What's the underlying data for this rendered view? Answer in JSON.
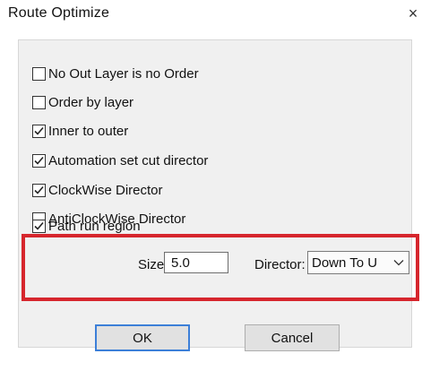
{
  "window": {
    "title": "Route Optimize",
    "close_glyph": "×",
    "close_icon": "close-icon"
  },
  "options": [
    {
      "label": "No Out Layer is no Order",
      "checked": false
    },
    {
      "label": "Order by layer",
      "checked": false
    },
    {
      "label": "Inner to outer",
      "checked": true
    },
    {
      "label": "Automation set cut director",
      "checked": true
    },
    {
      "label": "ClockWise Director",
      "checked": true
    },
    {
      "label": "AntiClockWise Director",
      "checked": false
    },
    {
      "label": "Path run region",
      "checked": true
    }
  ],
  "path_region": {
    "size_label": "Size:",
    "size_value": "5.0",
    "director_label": "Director:",
    "director_value": "Down To U",
    "director_icon": "chevron-down-icon"
  },
  "buttons": {
    "ok": "OK",
    "cancel": "Cancel"
  },
  "colors": {
    "highlight": "#d6262d",
    "panel": "#f0f0f0",
    "default_button_border": "#3c7fd8"
  }
}
